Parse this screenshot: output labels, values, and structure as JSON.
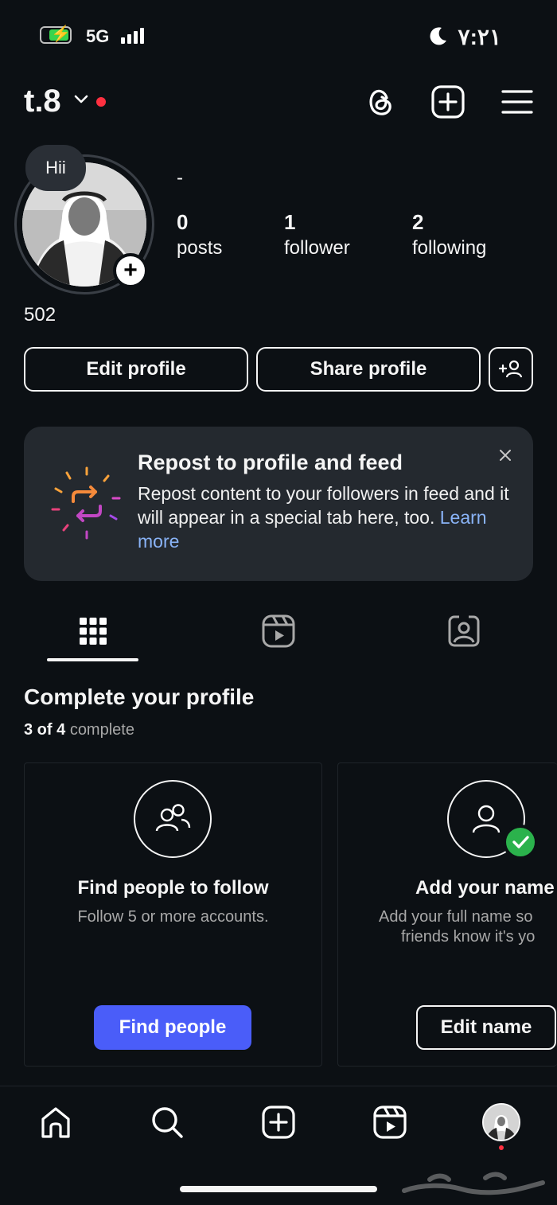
{
  "status_bar": {
    "network": "5G",
    "time": "٧:٢١"
  },
  "header": {
    "username": "t.8",
    "threads_icon": "threads-icon",
    "new_post_icon": "plus-square-icon",
    "menu_icon": "hamburger-menu-icon"
  },
  "profile": {
    "note": "Hii",
    "name": "-",
    "stats": [
      {
        "value": "0",
        "label": "posts"
      },
      {
        "value": "1",
        "label": "follower"
      },
      {
        "value": "2",
        "label": "following"
      }
    ],
    "bio": "502"
  },
  "actions": {
    "edit_profile": "Edit profile",
    "share_profile": "Share profile"
  },
  "repost_card": {
    "title": "Repost to profile and feed",
    "body": "Repost content to your followers in feed and it will appear in a special tab here, too.",
    "link": "Learn more"
  },
  "complete_profile": {
    "title": "Complete your profile",
    "progress_count": "3 of 4",
    "progress_word": "complete",
    "cards": [
      {
        "title": "Find people to follow",
        "desc": "Follow 5 or more accounts.",
        "button": "Find people"
      },
      {
        "title": "Add your name",
        "desc_line1": "Add your full name so",
        "desc_line2": "friends know it's yo",
        "button": "Edit name"
      }
    ]
  },
  "watermark": "حراج",
  "colors": {
    "background": "#0c1014",
    "primary_button": "#4a5df9",
    "card": "#24292f",
    "link": "#8ab4f8",
    "badge": "#ff3040",
    "check": "#2bb24c"
  }
}
